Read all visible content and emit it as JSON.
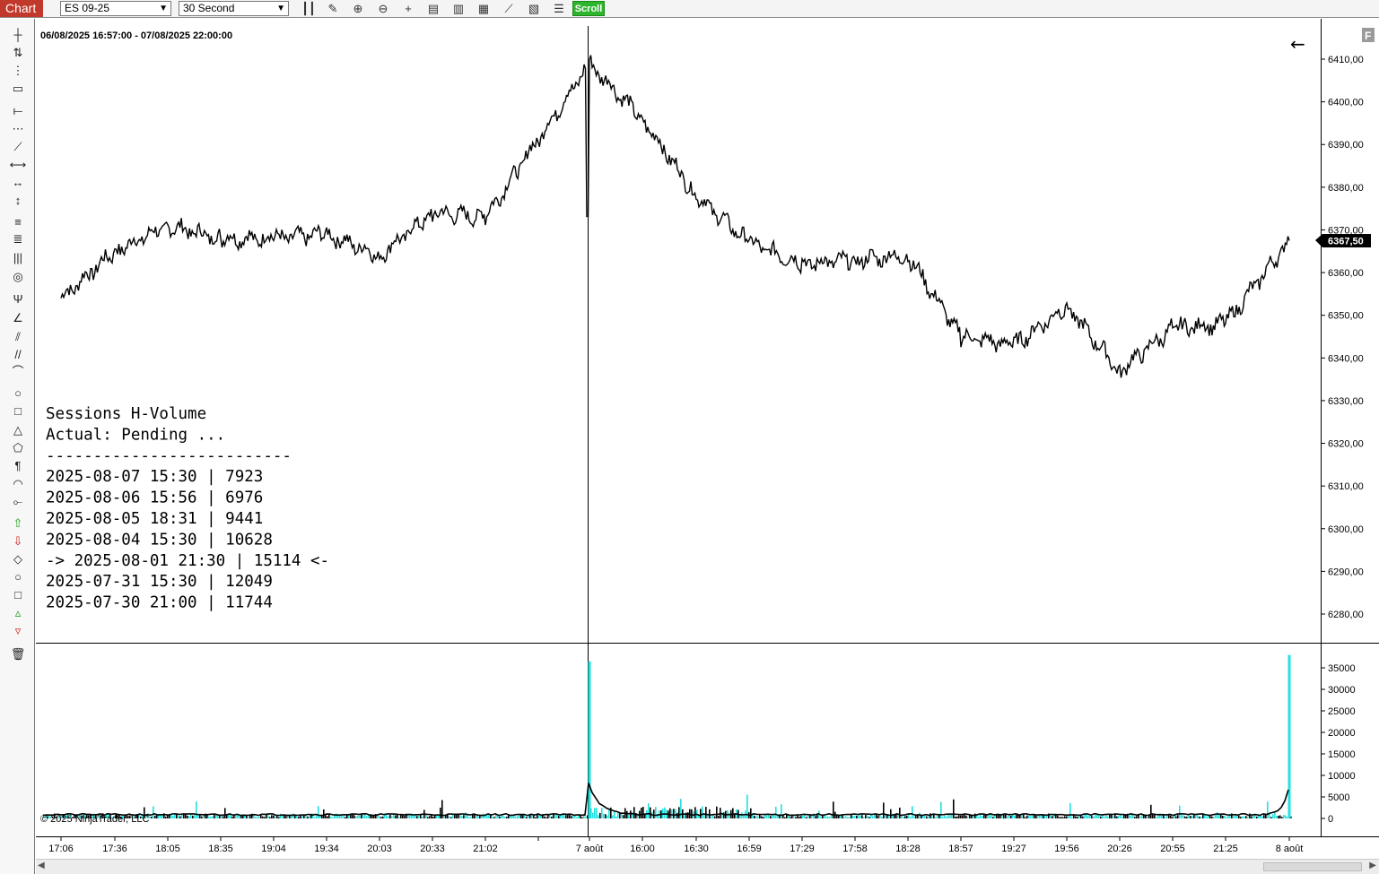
{
  "toolbar": {
    "chart_tab": "Chart",
    "instrument": "ES 09-25",
    "interval": "30 Second",
    "scroll_label": "Scroll",
    "icons": [
      "bars-icon",
      "pencil-icon",
      "zoom-in-icon",
      "zoom-out-icon",
      "crosshair-icon",
      "data-box-icon",
      "templates-icon",
      "indicators-icon",
      "strategies-icon",
      "properties-icon",
      "object-list-icon"
    ]
  },
  "drawing_tools": [
    "ruler-icon",
    "risk-reward-icon",
    "region-icon",
    "region-highlight-icon",
    "line-icon",
    "ray-icon",
    "extended-line-icon",
    "arrow-line-icon",
    "horizontal-line-icon",
    "vertical-line-icon",
    "fib-retracement-icon",
    "fib-extension-icon",
    "fib-time-icon",
    "fib-circle-icon",
    "andrews-pitchfork-icon",
    "gann-fan-icon",
    "regression-channel-icon",
    "trend-channel-icon",
    "time-cycles-icon",
    "ellipse-icon",
    "rectangle-icon",
    "triangle-icon",
    "polygon-icon",
    "text-icon",
    "arc-icon",
    "path-icon",
    "arrow-up-icon",
    "arrow-down-icon",
    "diamond-icon",
    "dot-icon",
    "square-icon",
    "triangle-up-icon",
    "triangle-down-icon",
    "remove-all-icon"
  ],
  "chart": {
    "date_range": "06/08/2025 16:57:00 - 07/08/2025 22:00:00",
    "current_price": "6367,50",
    "back_arrow": "←",
    "panel_icon": "F",
    "copyright": "© 2025 NinjaTrader, LLC",
    "price_axis": [
      "6410,00",
      "6400,00",
      "6390,00",
      "6380,00",
      "6370,00",
      "6360,00",
      "6350,00",
      "6340,00",
      "6330,00",
      "6320,00",
      "6310,00",
      "6300,00",
      "6290,00",
      "6280,00"
    ],
    "volume_axis": [
      "35000",
      "30000",
      "25000",
      "20000",
      "15000",
      "10000",
      "5000",
      "0"
    ],
    "time_axis": [
      "17:06",
      "17:36",
      "18:05",
      "18:35",
      "19:04",
      "19:34",
      "20:03",
      "20:33",
      "21:02",
      "7 août",
      "16:00",
      "16:30",
      "16:59",
      "17:29",
      "17:58",
      "18:28",
      "18:57",
      "19:27",
      "19:56",
      "20:26",
      "20:55",
      "21:25",
      "8 août"
    ],
    "colors": {
      "price_line": "#000000",
      "volume_bar": "#22e0e0",
      "volume_avg": "#000000",
      "current_price_bg": "#000000"
    }
  },
  "indicator_note": [
    "Sessions H-Volume",
    "Actual: Pending ...",
    "--------------------------",
    "2025-08-07 15:30 | 7923",
    "2025-08-06 15:56 | 6976",
    "2025-08-05 18:31 | 9441",
    "2025-08-04 15:30 | 10628",
    "-> 2025-08-01 21:30 | 15114 <-",
    "2025-07-31 15:30 | 12049",
    "2025-07-30 21:00 | 11744"
  ],
  "chart_data": {
    "type": "line",
    "title": "",
    "xlabel": "",
    "ylabel": "",
    "series": [
      {
        "x": [
          "17:06",
          "17:36",
          "18:05",
          "18:35",
          "19:04",
          "19:34",
          "20:03",
          "20:33",
          "21:02",
          "7 août",
          "16:00",
          "16:30",
          "16:59",
          "17:29",
          "17:58",
          "18:28",
          "18:57",
          "19:27",
          "19:56",
          "20:26",
          "20:55",
          "21:25",
          "8 août"
        ],
        "values": [
          6354,
          6365,
          6371,
          6368,
          6368,
          6369,
          6364,
          6374,
          6373,
          6409,
          6396,
          6378,
          6367,
          6362,
          6363,
          6364,
          6345,
          6343,
          6352,
          6337,
          6347,
          6348,
          6367.5
        ]
      }
    ],
    "volume_spikes": [
      {
        "x": "7 août",
        "value": 36500
      },
      {
        "x": "8 août",
        "value": 38000
      }
    ],
    "ylim": [
      6275,
      6415
    ],
    "volume_ylim": [
      0,
      38000
    ],
    "grid": false
  }
}
